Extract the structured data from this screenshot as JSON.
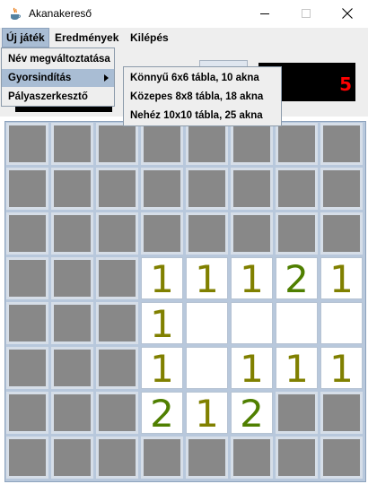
{
  "window": {
    "title": "Akanakereső"
  },
  "menubar": {
    "items": [
      "Új játék",
      "Eredmények",
      "Kilépés"
    ]
  },
  "new_game_menu": {
    "items": [
      "Név megváltoztatása",
      "Gyorsindítás",
      "Pályaszerkesztő"
    ]
  },
  "quick_start_submenu": {
    "items": [
      "Könnyű 6x6 tábla, 10 akna",
      "Közepes 8x8 tábla, 18 akna",
      "Nehéz 10x10 tábla, 25 akna"
    ]
  },
  "counter": {
    "value": "5",
    "color": "#ff0000"
  },
  "board": {
    "rows": 8,
    "cols": 8,
    "cells": [
      [
        "c",
        "c",
        "c",
        "c",
        "c",
        "c",
        "c",
        "c"
      ],
      [
        "c",
        "c",
        "c",
        "c",
        "c",
        "c",
        "c",
        "c"
      ],
      [
        "c",
        "c",
        "c",
        "c",
        "c",
        "c",
        "c",
        "c"
      ],
      [
        "c",
        "c",
        "c",
        "1",
        "1",
        "1",
        "2",
        "1"
      ],
      [
        "c",
        "c",
        "c",
        "1",
        "0",
        "0",
        "0",
        "0"
      ],
      [
        "c",
        "c",
        "c",
        "1",
        "0",
        "1",
        "1",
        "1"
      ],
      [
        "c",
        "c",
        "c",
        "2",
        "1",
        "2",
        "c",
        "c"
      ],
      [
        "c",
        "c",
        "c",
        "c",
        "c",
        "c",
        "c",
        "c"
      ]
    ],
    "number_colors": {
      "1": "#808000",
      "2": "#4f7f00"
    }
  }
}
